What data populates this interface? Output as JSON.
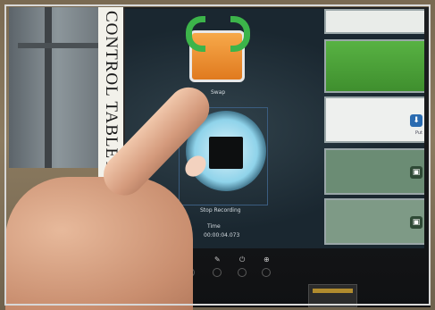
{
  "tablet": {
    "vertical_label": "CONTROL TABLET"
  },
  "screen": {
    "swap_label": "Swap",
    "stop_label": "Stop Recording",
    "time_label": "Time",
    "time_value": "00:00:04.073",
    "right_tiles": {
      "put_label": "Put"
    }
  },
  "icons": [
    "swap-icon",
    "stop-icon",
    "put-icon",
    "save-icon"
  ],
  "colors": {
    "record_ring": "#8fd3ea",
    "swap_orange": "#e07a1f",
    "swap_arrows": "#3cb44a",
    "tile_green": "#58b243"
  }
}
